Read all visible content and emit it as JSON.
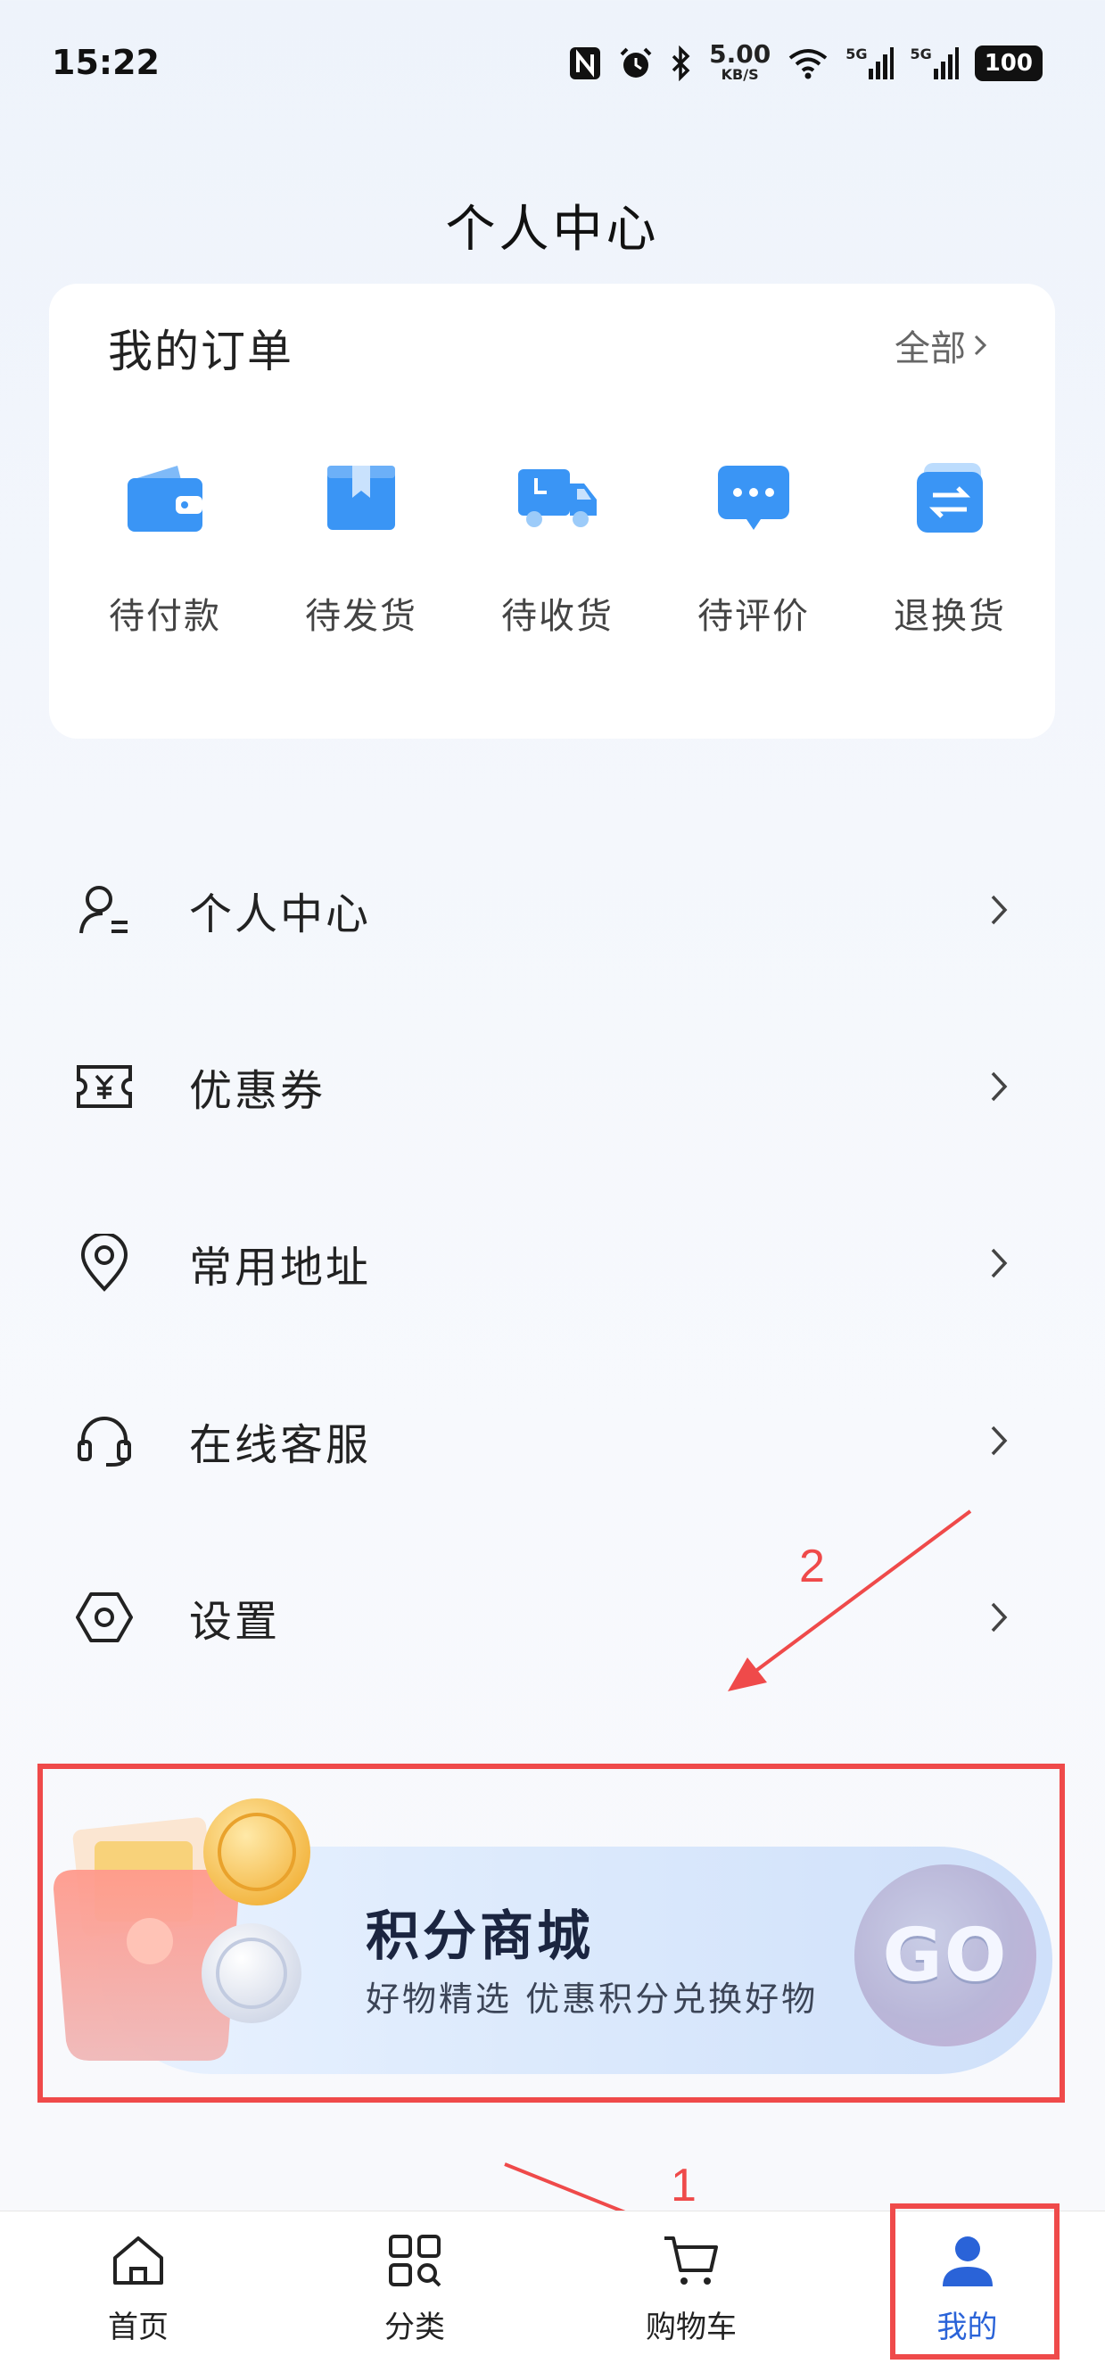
{
  "status_bar": {
    "time": "15:22",
    "net_speed": "5.00",
    "net_speed_unit": "KB/S",
    "sig1": "5G",
    "sig2": "5G",
    "battery": "100"
  },
  "header": {
    "title": "个人中心"
  },
  "orders": {
    "title": "我的订单",
    "all_label": "全部",
    "items": [
      {
        "label": "待付款",
        "icon": "wallet-icon"
      },
      {
        "label": "待发货",
        "icon": "package-icon"
      },
      {
        "label": "待收货",
        "icon": "truck-icon"
      },
      {
        "label": "待评价",
        "icon": "comment-icon"
      },
      {
        "label": "退换货",
        "icon": "exchange-icon"
      }
    ]
  },
  "menu": [
    {
      "label": "个人中心",
      "icon": "user-icon"
    },
    {
      "label": "优惠券",
      "icon": "coupon-icon"
    },
    {
      "label": "常用地址",
      "icon": "location-icon"
    },
    {
      "label": "在线客服",
      "icon": "headset-icon"
    },
    {
      "label": "设置",
      "icon": "settings-icon"
    }
  ],
  "banner": {
    "title": "积分商城",
    "subtitle": "好物精选 优惠积分兑换好物",
    "go_label": "GO"
  },
  "annotations": {
    "one": "1",
    "two": "2"
  },
  "nav": [
    {
      "label": "首页",
      "icon": "home-icon"
    },
    {
      "label": "分类",
      "icon": "category-icon"
    },
    {
      "label": "购物车",
      "icon": "cart-icon"
    },
    {
      "label": "我的",
      "icon": "profile-icon"
    }
  ],
  "colors": {
    "accent": "#2a63d8",
    "icon_blue": "#3a95f5",
    "annotation_red": "#ef4a4a"
  }
}
